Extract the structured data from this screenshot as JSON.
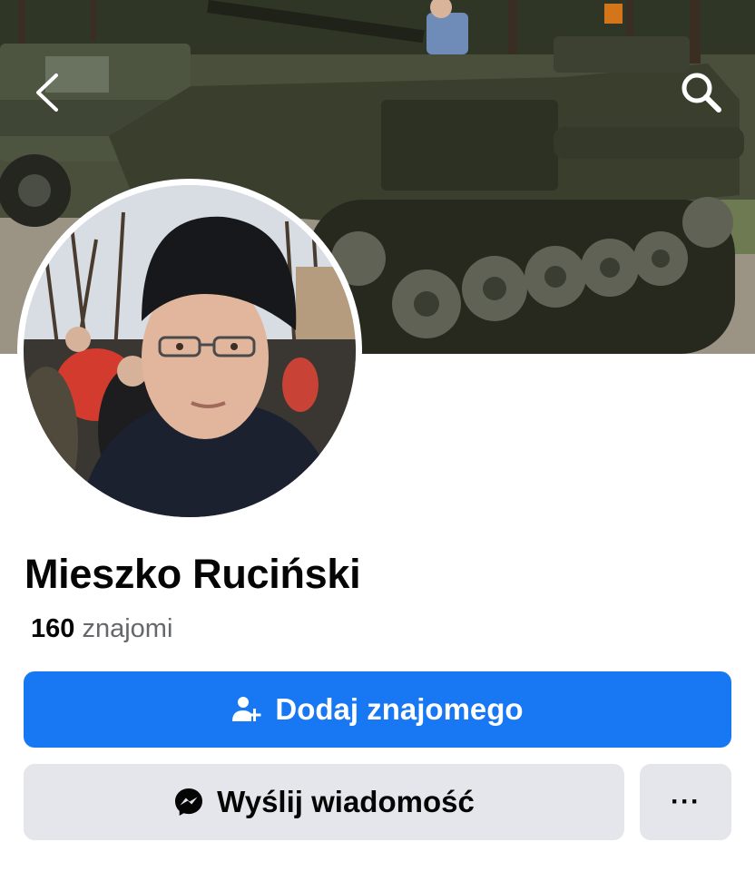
{
  "profile": {
    "name": "Mieszko Ruciński",
    "friends_count": "160",
    "friends_label": "znajomi"
  },
  "actions": {
    "add_friend_label": "Dodaj znajomego",
    "message_label": "Wyślij wiadomość",
    "more_label": "···"
  },
  "icons": {
    "back": "chevron-left-icon",
    "search": "search-icon",
    "add_friend": "add-person-icon",
    "messenger": "messenger-icon"
  },
  "colors": {
    "accent": "#1877f2",
    "secondary_button": "#e4e6eb",
    "text_primary": "#050505",
    "text_secondary": "#65676b"
  }
}
